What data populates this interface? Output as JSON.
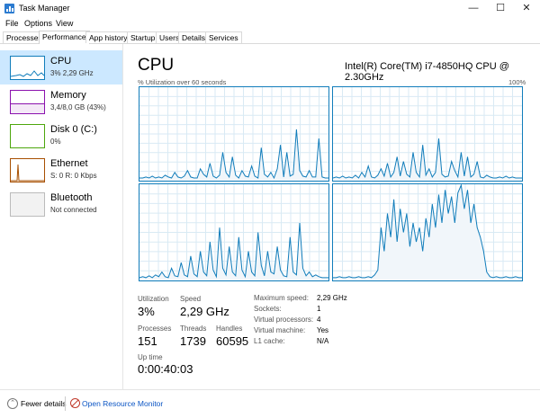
{
  "window": {
    "title": "Task Manager",
    "minimize": "—",
    "maximize": "☐",
    "close": "✕"
  },
  "menu": [
    "File",
    "Options",
    "View"
  ],
  "tabs": [
    "Processes",
    "Performance",
    "App history",
    "Startup",
    "Users",
    "Details",
    "Services"
  ],
  "active_tab": "Performance",
  "sidebar": [
    {
      "name": "CPU",
      "sub": "3% 2,29 GHz",
      "color": "#117dbb",
      "active": true
    },
    {
      "name": "Memory",
      "sub": "3,4/8,0 GB (43%)",
      "color": "#8b12ae",
      "active": false
    },
    {
      "name": "Disk 0 (C:)",
      "sub": "0%",
      "color": "#4da60c",
      "active": false
    },
    {
      "name": "Ethernet",
      "sub": "S: 0 R: 0 Kbps",
      "color": "#a74f01",
      "active": false
    },
    {
      "name": "Bluetooth",
      "sub": "Not connected",
      "color": "#999999",
      "active": false
    }
  ],
  "main": {
    "title": "CPU",
    "model": "Intel(R) Core(TM) i7-4850HQ CPU @ 2.30GHz",
    "util_label": "% Utilization over 60 seconds",
    "util_max": "100%",
    "graph_color": "#117dbb",
    "graph_fill": "#f1f6fa",
    "graphs": [
      [
        2,
        2,
        3,
        2,
        4,
        2,
        3,
        2,
        5,
        3,
        2,
        8,
        3,
        2,
        4,
        10,
        3,
        2,
        2,
        12,
        6,
        3,
        18,
        4,
        2,
        5,
        30,
        8,
        3,
        25,
        5,
        2,
        10,
        4,
        3,
        15,
        4,
        2,
        35,
        6,
        3,
        8,
        2,
        12,
        38,
        3,
        30,
        4,
        6,
        55,
        10,
        4,
        3,
        10,
        3,
        3,
        45,
        3,
        2,
        2
      ],
      [
        2,
        3,
        2,
        4,
        2,
        3,
        2,
        5,
        2,
        8,
        3,
        15,
        3,
        2,
        5,
        12,
        4,
        18,
        3,
        8,
        25,
        4,
        20,
        6,
        3,
        30,
        8,
        3,
        38,
        5,
        12,
        3,
        8,
        45,
        6,
        3,
        4,
        20,
        10,
        3,
        30,
        4,
        25,
        3,
        6,
        20,
        3,
        2,
        5,
        3,
        2,
        2,
        3,
        2,
        4,
        2,
        3,
        2,
        2,
        2
      ],
      [
        2,
        3,
        2,
        4,
        2,
        5,
        3,
        8,
        3,
        2,
        12,
        4,
        3,
        18,
        5,
        3,
        25,
        6,
        3,
        30,
        8,
        4,
        40,
        10,
        3,
        55,
        12,
        5,
        35,
        8,
        4,
        45,
        10,
        3,
        30,
        8,
        4,
        50,
        15,
        4,
        30,
        8,
        6,
        35,
        10,
        4,
        3,
        45,
        8,
        5,
        60,
        12,
        4,
        8,
        3,
        5,
        3,
        2,
        2,
        2
      ],
      [
        2,
        2,
        3,
        2,
        2,
        3,
        2,
        2,
        3,
        2,
        2,
        3,
        2,
        5,
        10,
        55,
        30,
        70,
        45,
        85,
        40,
        75,
        50,
        70,
        35,
        60,
        40,
        55,
        30,
        65,
        45,
        80,
        55,
        90,
        60,
        95,
        70,
        88,
        60,
        92,
        100,
        75,
        95,
        60,
        80,
        55,
        45,
        30,
        8,
        3,
        2,
        3,
        2,
        2,
        3,
        2,
        2,
        3,
        2,
        2
      ]
    ],
    "stats": {
      "utilization": {
        "label": "Utilization",
        "value": "3%"
      },
      "speed": {
        "label": "Speed",
        "value": "2,29 GHz"
      },
      "processes": {
        "label": "Processes",
        "value": "151"
      },
      "threads": {
        "label": "Threads",
        "value": "1739"
      },
      "handles": {
        "label": "Handles",
        "value": "60595"
      },
      "uptime": {
        "label": "Up time",
        "value": "0:00:40:03"
      }
    },
    "specs": [
      {
        "label": "Maximum speed:",
        "value": "2,29 GHz"
      },
      {
        "label": "Sockets:",
        "value": "1"
      },
      {
        "label": "Virtual processors:",
        "value": "4"
      },
      {
        "label": "Virtual machine:",
        "value": "Yes"
      },
      {
        "label": "L1 cache:",
        "value": "N/A"
      }
    ]
  },
  "footer": {
    "fewer_details": "Fewer details",
    "open_resmon": "Open Resource Monitor"
  }
}
